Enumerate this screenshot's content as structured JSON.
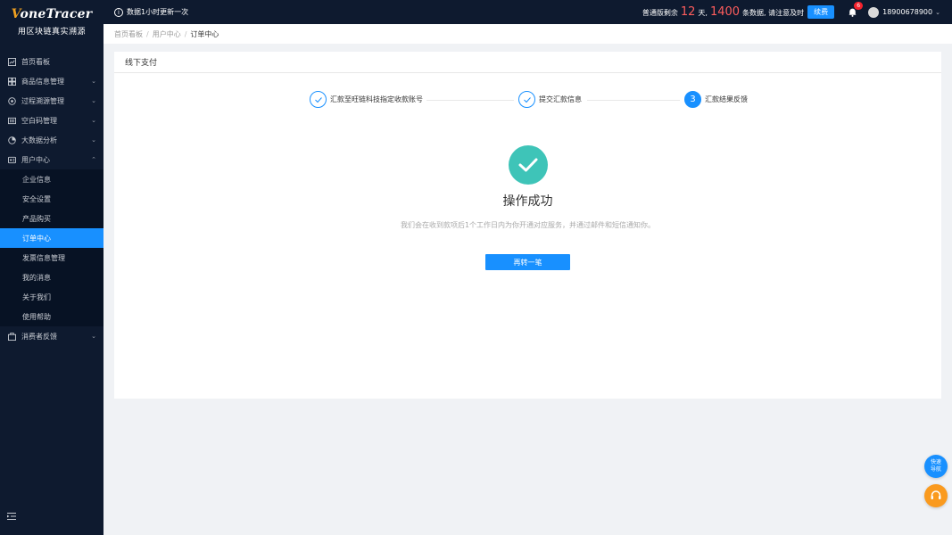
{
  "logo": {
    "v": "V",
    "rest": "oneTracer",
    "subtitle": "用区块链真实溯源"
  },
  "header": {
    "notice": "数据1小时更新一次",
    "plan_prefix": "普通版剩余",
    "days": "12",
    "days_unit": "天,",
    "count": "1400",
    "count_suffix": "条数据, 请注意及时",
    "renew_label": "续费",
    "badge_count": "6",
    "phone": "18900678900"
  },
  "sidebar": {
    "items": [
      {
        "label": "首页看板",
        "icon": "dashboard-icon",
        "has_chevron": false
      },
      {
        "label": "商品信息管理",
        "icon": "goods-icon",
        "has_chevron": true
      },
      {
        "label": "过程溯源管理",
        "icon": "trace-icon",
        "has_chevron": true
      },
      {
        "label": "空白码管理",
        "icon": "barcode-icon",
        "has_chevron": true
      },
      {
        "label": "大数据分析",
        "icon": "pie-chart-icon",
        "has_chevron": true
      },
      {
        "label": "用户中心",
        "icon": "user-card-icon",
        "has_chevron": true,
        "expanded": true
      }
    ],
    "subitems": [
      {
        "label": "企业信息"
      },
      {
        "label": "安全设置"
      },
      {
        "label": "产品购买"
      },
      {
        "label": "订单中心",
        "active": true
      },
      {
        "label": "发票信息管理"
      },
      {
        "label": "我的消息"
      },
      {
        "label": "关于我们"
      },
      {
        "label": "使用帮助"
      }
    ],
    "last_item": {
      "label": "消费者反馈",
      "icon": "feedback-icon"
    }
  },
  "breadcrumb": [
    "首页看板",
    "用户中心",
    "订单中心"
  ],
  "card": {
    "title": "线下支付",
    "steps": [
      {
        "label": "汇款至旺链科技指定收款账号",
        "status": "done"
      },
      {
        "label": "提交汇款信息",
        "status": "done"
      },
      {
        "label": "汇款结果反馈",
        "status": "active",
        "number": "3"
      }
    ],
    "result_title": "操作成功",
    "result_desc": "我们会在收到款项后1个工作日内为你开通对应服务，并通过邮件和短信通知你。",
    "again_button": "再转一笔"
  },
  "float": {
    "nav_line1": "快速",
    "nav_line2": "导航"
  },
  "colors": {
    "primary": "#1890ff",
    "sidebar_bg": "#0e1a2f",
    "success": "#3ec4b8",
    "highlight": "#ff5d5d",
    "service": "#fa9a1e"
  }
}
